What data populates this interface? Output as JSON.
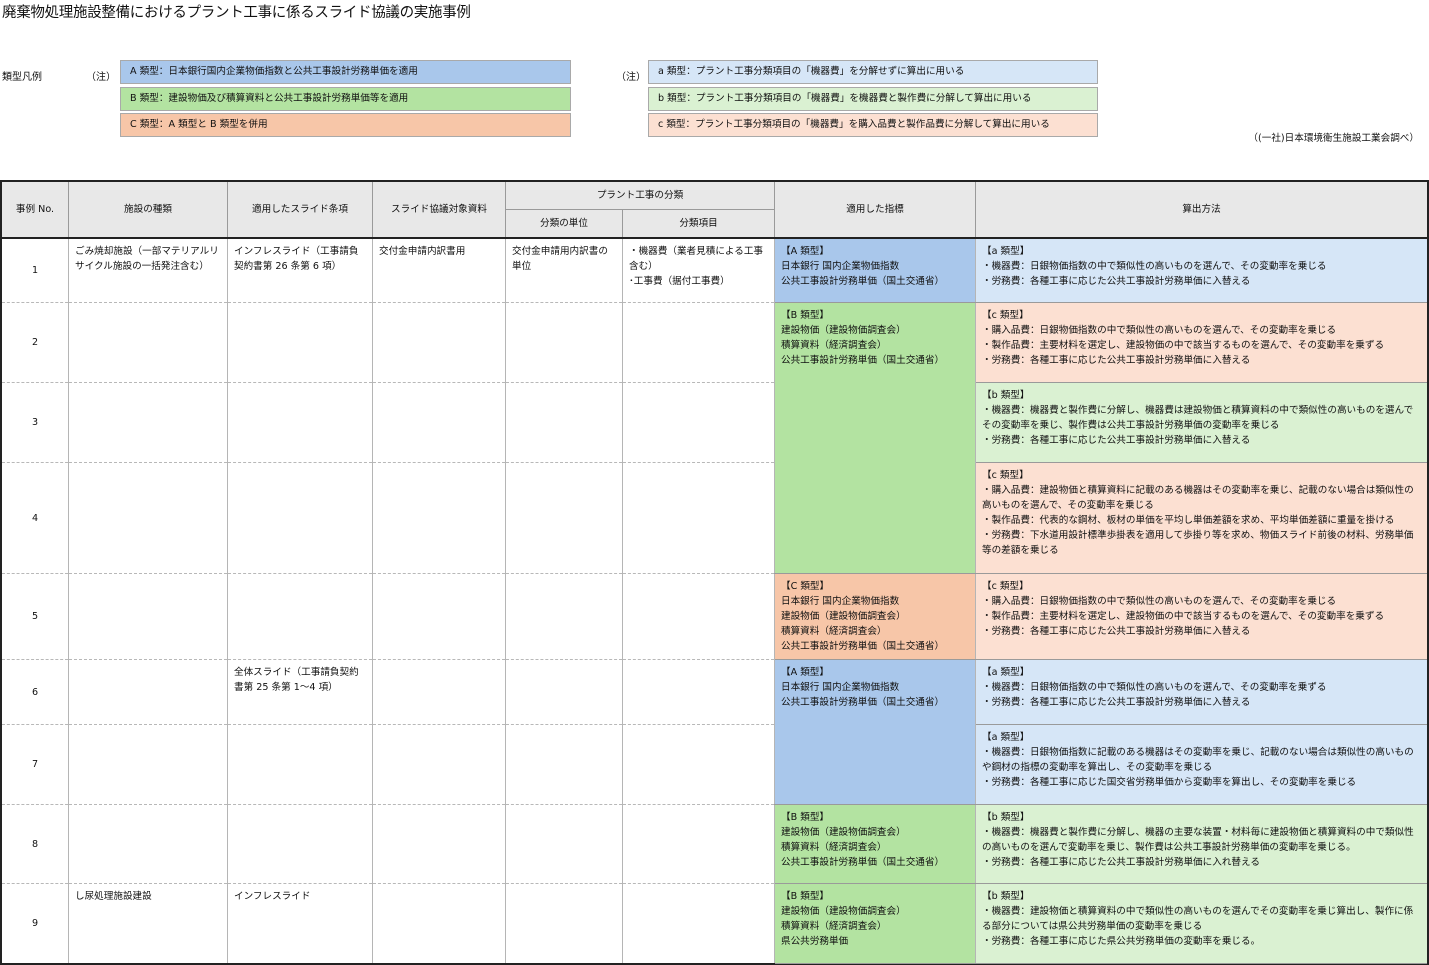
{
  "title": "廃棄物処理施設整備におけるプラント工事に係るスライド協議の実施事例",
  "legend": {
    "label": "類型凡例",
    "note_left": "（注）",
    "note_right": "（注）",
    "left": [
      {
        "text": "A 類型：日本銀行国内企業物価指数と公共工事設計労務単価を適用",
        "color": "#a9c7eb"
      },
      {
        "text": "B 類型：建設物価及び積算資料と公共工事設計労務単価等を適用",
        "color": "#b3e3a1"
      },
      {
        "text": "C 類型：A 類型と B 類型を併用",
        "color": "#f7c6a8"
      }
    ],
    "right": [
      {
        "text": "a 類型：プラント工事分類項目の「機器費」を分解せずに算出に用いる",
        "color": "#d6e6f7"
      },
      {
        "text": "b 類型：プラント工事分類項目の「機器費」を機器費と製作費に分解して算出に用いる",
        "color": "#daf1d2"
      },
      {
        "text": "c 類型：プラント工事分類項目の「機器費」を購入品費と製作品費に分解して算出に用いる",
        "color": "#fce0d2"
      }
    ]
  },
  "source": "（(一社)日本環境衛生施設工業会調べ）",
  "headers": {
    "no": "事例 No.",
    "facility": "施設の種類",
    "clause": "適用したスライド条項",
    "material": "スライド協議対象資料",
    "plant": "プラント工事の分類",
    "unit": "分類の単位",
    "item": "分類項目",
    "index": "適用した指標",
    "method": "算出方法"
  },
  "rows": [
    {
      "no": "1",
      "facility": "ごみ焼却施設（一部マテリアルリサイクル施設の一括発注含む）",
      "clause": "インフレスライド（工事請負契約書第 26 条第 6 項）",
      "material": "交付金申請内訳書用",
      "unit": "交付金申請用内訳書の単位",
      "items": [
        "・機器費（業者見積による工事含む）",
        "･工事費（据付工事費）"
      ]
    },
    {
      "no": "2",
      "facility": "",
      "clause": "",
      "material": "",
      "unit": "",
      "items": []
    },
    {
      "no": "3",
      "facility": "",
      "clause": "",
      "material": "",
      "unit": "",
      "items": []
    },
    {
      "no": "4",
      "facility": "",
      "clause": "",
      "material": "",
      "unit": "",
      "items": []
    },
    {
      "no": "5",
      "facility": "",
      "clause": "",
      "material": "",
      "unit": "",
      "items": []
    },
    {
      "no": "6",
      "facility": "",
      "clause": "全体スライド（工事請負契約書第 25 条第 1～4 項）",
      "material": "",
      "unit": "",
      "items": []
    },
    {
      "no": "7",
      "facility": "",
      "clause": "",
      "material": "",
      "unit": "",
      "items": []
    },
    {
      "no": "8",
      "facility": "",
      "clause": "",
      "material": "",
      "unit": "",
      "items": []
    },
    {
      "no": "9",
      "facility": "し尿処理施設建設",
      "clause": "インフレスライド",
      "material": "",
      "unit": "",
      "items": []
    }
  ],
  "indices": [
    {
      "rows": "1",
      "color": "#a9c7eb",
      "lines": [
        "【A 類型】",
        "日本銀行 国内企業物価指数",
        "公共工事設計労務単価（国土交通省）"
      ]
    },
    {
      "rows": "2-4",
      "color": "#b3e3a1",
      "lines": [
        "【B 類型】",
        "建設物価（建設物価調査会）",
        "積算資料（経済調査会）",
        "公共工事設計労務単価（国土交通省）"
      ]
    },
    {
      "rows": "5",
      "color": "#f7c6a8",
      "lines": [
        "【C 類型】",
        "日本銀行 国内企業物価指数",
        "建設物価（建設物価調査会）",
        "積算資料（経済調査会）",
        "公共工事設計労務単価（国土交通省）"
      ]
    },
    {
      "rows": "6-7",
      "color": "#a9c7eb",
      "lines": [
        "【A 類型】",
        "日本銀行 国内企業物価指数",
        "公共工事設計労務単価（国土交通省）"
      ]
    },
    {
      "rows": "8",
      "color": "#b3e3a1",
      "lines": [
        "【B 類型】",
        "建設物価（建設物価調査会）",
        "積算資料（経済調査会）",
        "公共工事設計労務単価（国土交通省）"
      ]
    },
    {
      "rows": "9",
      "color": "#b3e3a1",
      "lines": [
        "【B 類型】",
        "建設物価（建設物価調査会）",
        "積算資料（経済調査会）",
        "県公共労務単価"
      ]
    }
  ],
  "methods": [
    {
      "color": "#d6e6f7",
      "lines": [
        "【a 類型】",
        "・機器費：日銀物価指数の中で類似性の高いものを選んで、その変動率を乗じる",
        "・労務費：各種工事に応じた公共工事設計労務単価に入替える"
      ]
    },
    {
      "color": "#fce0d2",
      "lines": [
        "【c 類型】",
        "・購入品費：日銀物価指数の中で類似性の高いものを選んで、その変動率を乗じる",
        "・製作品費：主要材料を選定し、建設物価の中で該当するものを選んで、その変動率を乗ずる",
        "・労務費：各種工事に応じた公共工事設計労務単価に入替える"
      ]
    },
    {
      "color": "#daf1d2",
      "lines": [
        "【b 類型】",
        "・機器費：機器費と製作費に分解し、機器費は建設物価と積算資料の中で類似性の高いものを選んでその変動率を乗じ、製作費は公共工事設計労務単価の変動率を乗じる",
        "・労務費：各種工事に応じた公共工事設計労務単価に入替える"
      ]
    },
    {
      "color": "#fce0d2",
      "lines": [
        "【c 類型】",
        "・購入品費：建設物価と積算資料に記載のある機器はその変動率を乗じ、記載のない場合は類似性の高いものを選んで、その変動率を乗じる",
        "・製作品費：代表的な鋼材、板材の単価を平均し単価差額を求め、平均単価差額に重量を掛ける",
        "・労務費：下水道用設計標準歩掛表を適用して歩掛り等を求め、物価スライド前後の材料、労務単価等の差額を乗じる"
      ]
    },
    {
      "color": "#fce0d2",
      "lines": [
        "【c 類型】",
        "・購入品費：日銀物価指数の中で類似性の高いものを選んで、その変動率を乗じる",
        "・製作品費：主要材料を選定し、建設物価の中で該当するものを選んで、その変動率を乗ずる",
        "・労務費：各種工事に応じた公共工事設計労務単価に入替える"
      ]
    },
    {
      "color": "#d6e6f7",
      "lines": [
        "【a 類型】",
        "・機器費：日銀物価指数の中で類似性の高いものを選んで、その変動率を乗ずる",
        "・労務費：各種工事に応じた公共工事設計労務単価に入替える"
      ]
    },
    {
      "color": "#d6e6f7",
      "lines": [
        "【a 類型】",
        "・機器費：日銀物価指数に記載のある機器はその変動率を乗じ、記載のない場合は類似性の高いものや鋼材の指標の変動率を算出し、その変動率を乗じる",
        "・労務費：各種工事に応じた国交省労務単価から変動率を算出し、その変動率を乗じる"
      ]
    },
    {
      "color": "#daf1d2",
      "lines": [
        "【b 類型】",
        "・機器費：機器費と製作費に分解し、機器の主要な装置・材料毎に建設物価と積算資料の中で類似性の高いものを選んで変動率を乗じ、製作費は公共工事設計労務単価の変動率を乗じる。",
        "・労務費：各種工事に応じた公共工事設計労務単価に入れ替える"
      ]
    },
    {
      "color": "#daf1d2",
      "lines": [
        "【b 類型】",
        "・機器費：建設物価と積算資料の中で類似性の高いものを選んでその変動率を乗じ算出し、製作に係る部分については県公共労務単価の変動率を乗じる",
        "・労務費：各種工事に応じた県公共労務単価の変動率を乗じる。"
      ]
    }
  ]
}
